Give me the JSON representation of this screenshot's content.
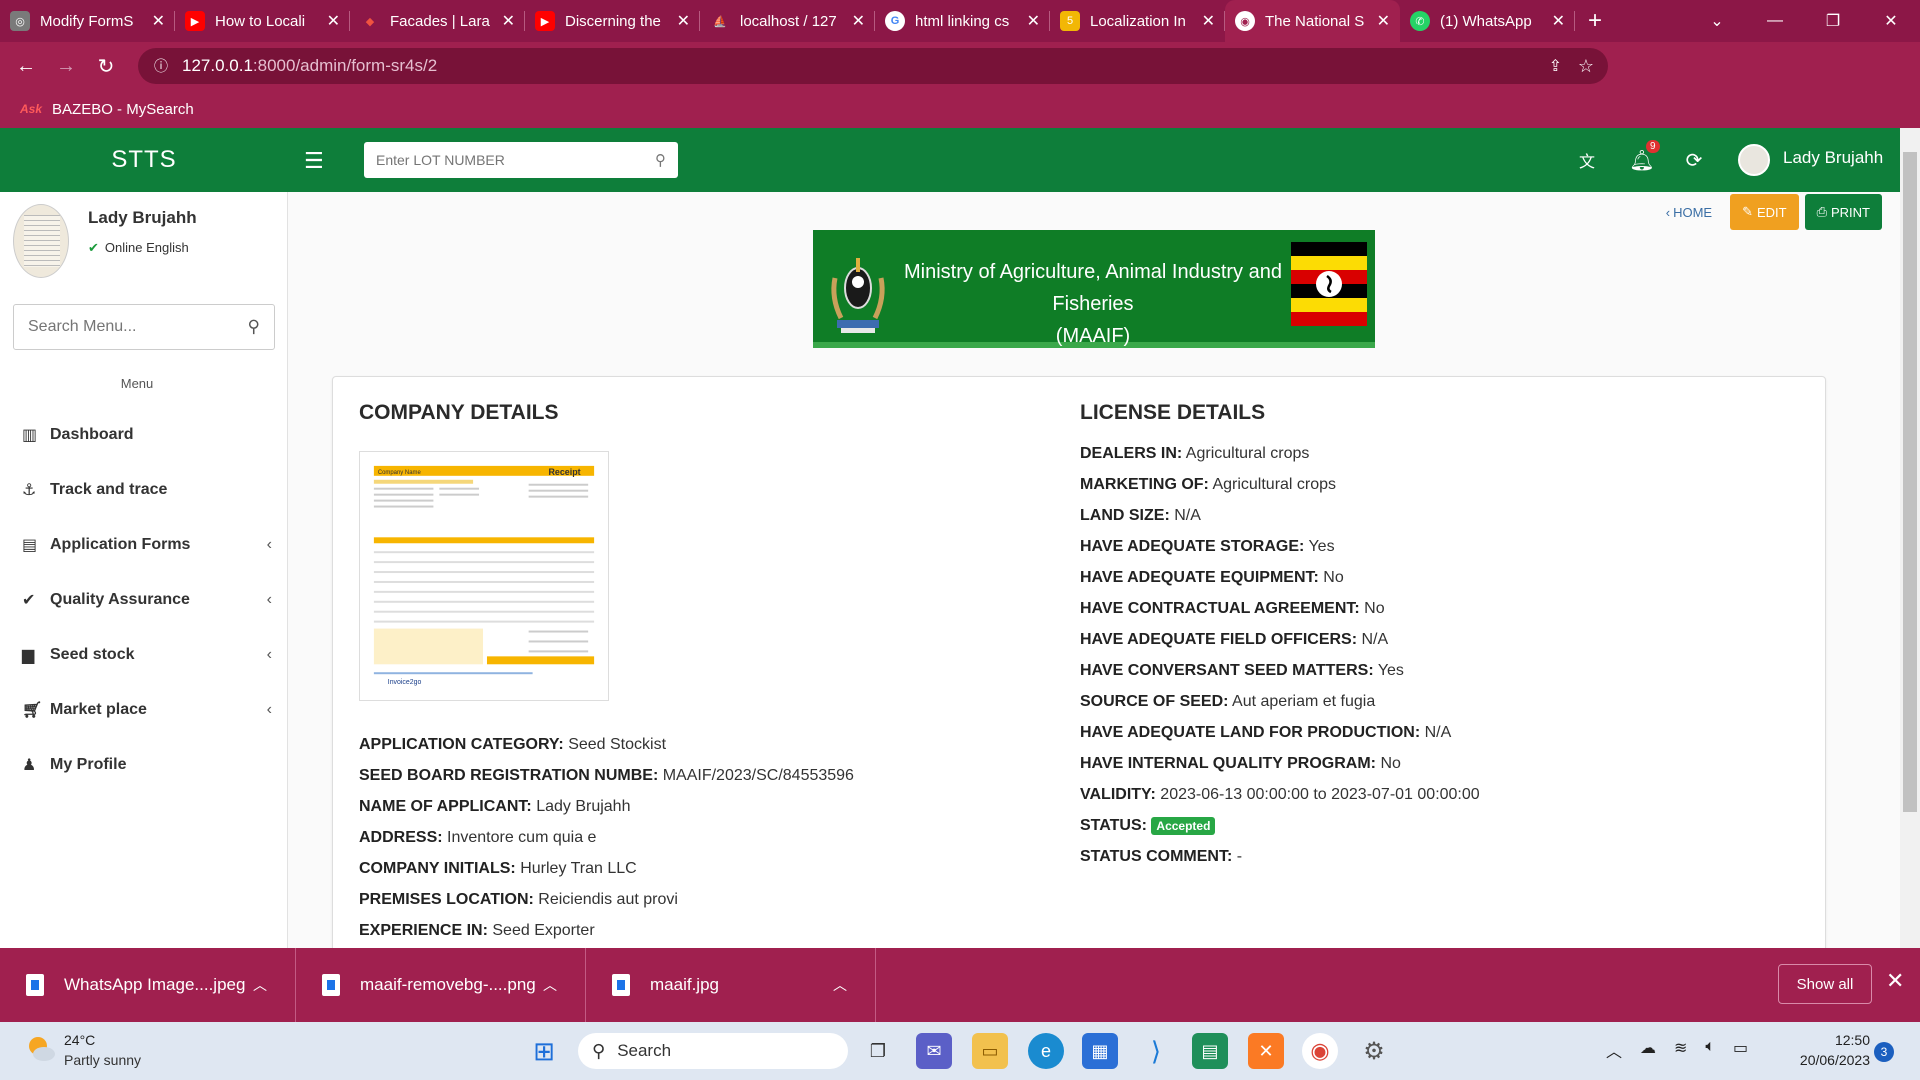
{
  "browser": {
    "tabs": [
      {
        "label": "Modify FormS",
        "icon": "app-icon",
        "color": "#7a7a7a"
      },
      {
        "label": "How to Locali",
        "icon": "youtube-icon",
        "color": "#ff0000"
      },
      {
        "label": "Facades | Lara",
        "icon": "laravel-icon",
        "color": "#f05340"
      },
      {
        "label": "Discerning the",
        "icon": "youtube-icon",
        "color": "#ff0000"
      },
      {
        "label": "localhost / 127",
        "icon": "phpmyadmin-icon",
        "color": "#f29111"
      },
      {
        "label": "html linking cs",
        "icon": "google-icon",
        "color": "#ffffff"
      },
      {
        "label": "Localization In",
        "icon": "bookmark-site-icon",
        "color": "#f2b705"
      },
      {
        "label": "The National S",
        "icon": "globe-icon",
        "color": "#ffffff"
      },
      {
        "label": "(1) WhatsApp",
        "icon": "whatsapp-icon",
        "color": "#25d366"
      }
    ],
    "url_host": "127.0.0.1",
    "url_path": ":8000/admin/form-sr4s/2",
    "bookmark": "BAZEBO - MySearch"
  },
  "header": {
    "brand": "STTS",
    "lot_placeholder": "Enter LOT NUMBER",
    "notification_count": "9",
    "user_name": "Lady Brujahh"
  },
  "sidebar": {
    "user_name": "Lady Brujahh",
    "status": "Online English",
    "search_placeholder": "Search Menu...",
    "menu_heading": "Menu",
    "items": [
      {
        "label": "Dashboard",
        "icon": "bar-chart-icon",
        "has_submenu": false
      },
      {
        "label": "Track and trace",
        "icon": "anchor-icon",
        "has_submenu": false
      },
      {
        "label": "Application Forms",
        "icon": "list-icon",
        "has_submenu": true
      },
      {
        "label": "Quality Assurance",
        "icon": "check-icon",
        "has_submenu": true
      },
      {
        "label": "Seed stock",
        "icon": "inbox-icon",
        "has_submenu": true
      },
      {
        "label": "Market place",
        "icon": "cart-icon",
        "has_submenu": true
      },
      {
        "label": "My Profile",
        "icon": "user-icon",
        "has_submenu": false
      }
    ]
  },
  "toolbar": {
    "home": "HOME",
    "edit": "EDIT",
    "print": "PRINT"
  },
  "banner": {
    "line1": "Ministry of Agriculture, Animal Industry and Fisheries",
    "line2": "(MAAIF)"
  },
  "company": {
    "title": "COMPANY DETAILS",
    "receipt_image": {
      "company_name": "Company Name",
      "doc_title": "Receipt",
      "footer": "Invoice2go"
    },
    "fields": [
      {
        "label": "APPLICATION CATEGORY:",
        "value": "Seed Stockist"
      },
      {
        "label": "SEED BOARD REGISTRATION NUMBE:",
        "value": "MAAIF/2023/SC/84553596"
      },
      {
        "label": "NAME OF APPLICANT:",
        "value": "Lady Brujahh"
      },
      {
        "label": "ADDRESS:",
        "value": "Inventore cum quia e"
      },
      {
        "label": "COMPANY INITIALS:",
        "value": "Hurley Tran LLC"
      },
      {
        "label": "PREMISES LOCATION:",
        "value": "Reiciendis aut provi"
      },
      {
        "label": "EXPERIENCE IN:",
        "value": "Seed Exporter"
      }
    ]
  },
  "license": {
    "title": "LICENSE DETAILS",
    "fields": [
      {
        "label": "DEALERS IN:",
        "value": "Agricultural crops"
      },
      {
        "label": "MARKETING OF:",
        "value": "Agricultural crops"
      },
      {
        "label": "LAND SIZE:",
        "value": "N/A"
      },
      {
        "label": "HAVE ADEQUATE STORAGE:",
        "value": "Yes"
      },
      {
        "label": "HAVE ADEQUATE EQUIPMENT:",
        "value": "No"
      },
      {
        "label": "HAVE CONTRACTUAL AGREEMENT:",
        "value": "No"
      },
      {
        "label": "HAVE ADEQUATE FIELD OFFICERS:",
        "value": "N/A"
      },
      {
        "label": "HAVE CONVERSANT SEED MATTERS:",
        "value": "Yes"
      },
      {
        "label": "SOURCE OF SEED:",
        "value": "Aut aperiam et fugia"
      },
      {
        "label": "HAVE ADEQUATE LAND FOR PRODUCTION:",
        "value": "N/A"
      },
      {
        "label": "HAVE INTERNAL QUALITY PROGRAM:",
        "value": "No"
      },
      {
        "label": "VALIDITY:",
        "value": "2023-06-13 00:00:00 to 2023-07-01 00:00:00"
      }
    ],
    "status_label": "STATUS:",
    "status_value": "Accepted",
    "status_color": "#28a745",
    "comment_label": "STATUS COMMENT:",
    "comment_value": "-"
  },
  "downloads": {
    "items": [
      {
        "name": "WhatsApp Image....jpeg"
      },
      {
        "name": "maaif-removebg-....png"
      },
      {
        "name": "maaif.jpg"
      }
    ],
    "show_all": "Show all"
  },
  "taskbar": {
    "weather_temp": "24°C",
    "weather_desc": "Partly sunny",
    "search_label": "Search",
    "time": "12:50",
    "date": "20/06/2023",
    "notification_count": "3"
  },
  "colors": {
    "browser_frame": "#a0204f",
    "app_green": "#0e7e3a",
    "edit_orange": "#f0a020"
  }
}
